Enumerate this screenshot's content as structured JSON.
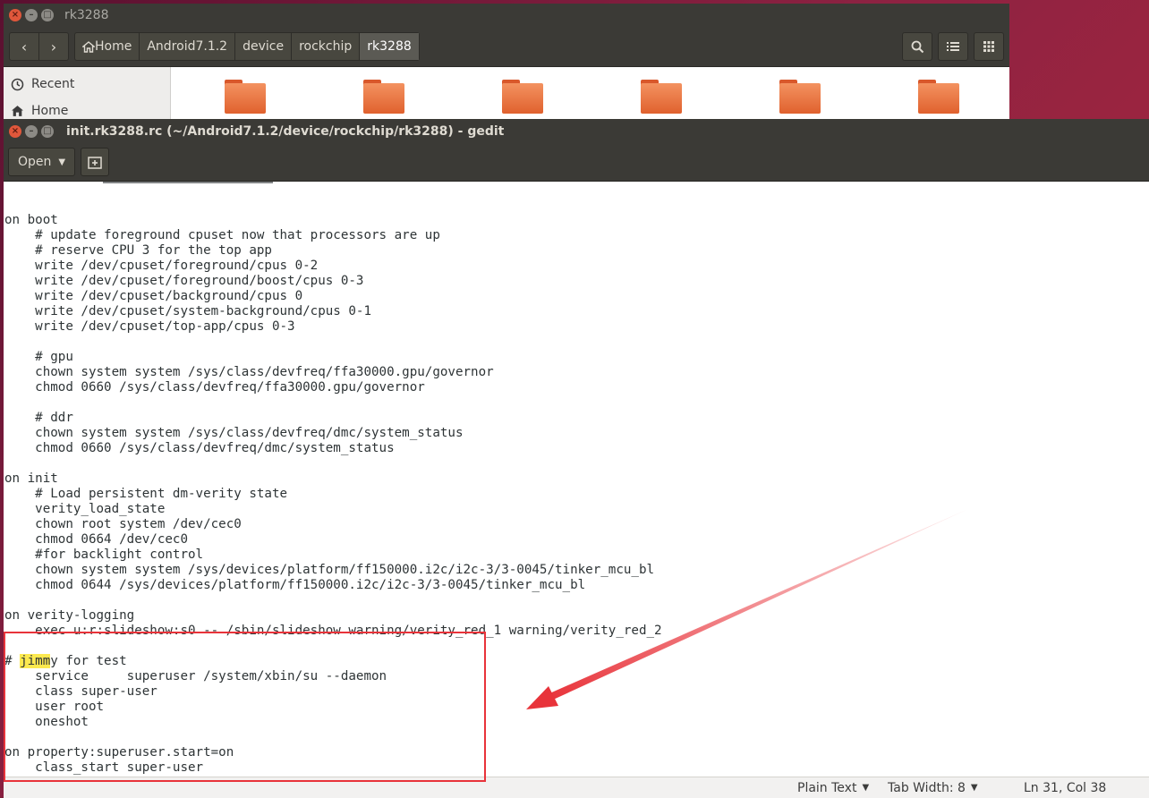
{
  "file_manager": {
    "title": "rk3288",
    "nav": {
      "back_icon": "chevron-left-icon",
      "forward_icon": "chevron-right-icon"
    },
    "breadcrumbs": [
      {
        "label": "Home",
        "icon": "home-icon"
      },
      {
        "label": "Android7.1.2"
      },
      {
        "label": "device"
      },
      {
        "label": "rockchip"
      },
      {
        "label": "rk3288",
        "active": true
      }
    ],
    "sidebar": [
      {
        "label": "Recent",
        "icon": "clock-icon"
      },
      {
        "label": "Home",
        "icon": "home-icon"
      }
    ],
    "folder_count": 6,
    "folder_color": "#e0612e"
  },
  "gedit": {
    "title": "init.rk3288.rc (~/Android7.1.2/device/rockchip/rk3288) - gedit",
    "open_label": "Open",
    "code_lines": [
      "",
      "on boot",
      "    # update foreground cpuset now that processors are up",
      "    # reserve CPU 3 for the top app",
      "    write /dev/cpuset/foreground/cpus 0-2",
      "    write /dev/cpuset/foreground/boost/cpus 0-3",
      "    write /dev/cpuset/background/cpus 0",
      "    write /dev/cpuset/system-background/cpus 0-1",
      "    write /dev/cpuset/top-app/cpus 0-3",
      "",
      "    # gpu",
      "    chown system system /sys/class/devfreq/ffa30000.gpu/governor",
      "    chmod 0660 /sys/class/devfreq/ffa30000.gpu/governor",
      "",
      "    # ddr",
      "    chown system system /sys/class/devfreq/dmc/system_status",
      "    chmod 0660 /sys/class/devfreq/dmc/system_status",
      "",
      "on init",
      "    # Load persistent dm-verity state",
      "    verity_load_state",
      "    chown root system /dev/cec0",
      "    chmod 0664 /dev/cec0",
      "    #for backlight control",
      "    chown system system /sys/devices/platform/ff150000.i2c/i2c-3/3-0045/tinker_mcu_bl",
      "    chmod 0644 /sys/devices/platform/ff150000.i2c/i2c-3/3-0045/tinker_mcu_bl",
      "",
      "on verity-logging",
      "    exec u:r:slideshow:s0 -- /sbin/slideshow warning/verity_red_1 warning/verity_red_2",
      "",
      "# jimmy for test",
      "    service     superuser /system/xbin/su --daemon",
      "    class super-user",
      "    user root",
      "    oneshot",
      "",
      "on property:superuser.start=on",
      "    class_start super-user",
      "# #####################"
    ],
    "search_highlight": "jimm",
    "status": {
      "language": "Plain Text",
      "tab_width": "Tab Width: 8",
      "position": "Ln 31, Col 38"
    }
  },
  "colors": {
    "titlebar": "#3b3a36",
    "highlight": "#fce94f",
    "annotation": "#e8333a"
  }
}
